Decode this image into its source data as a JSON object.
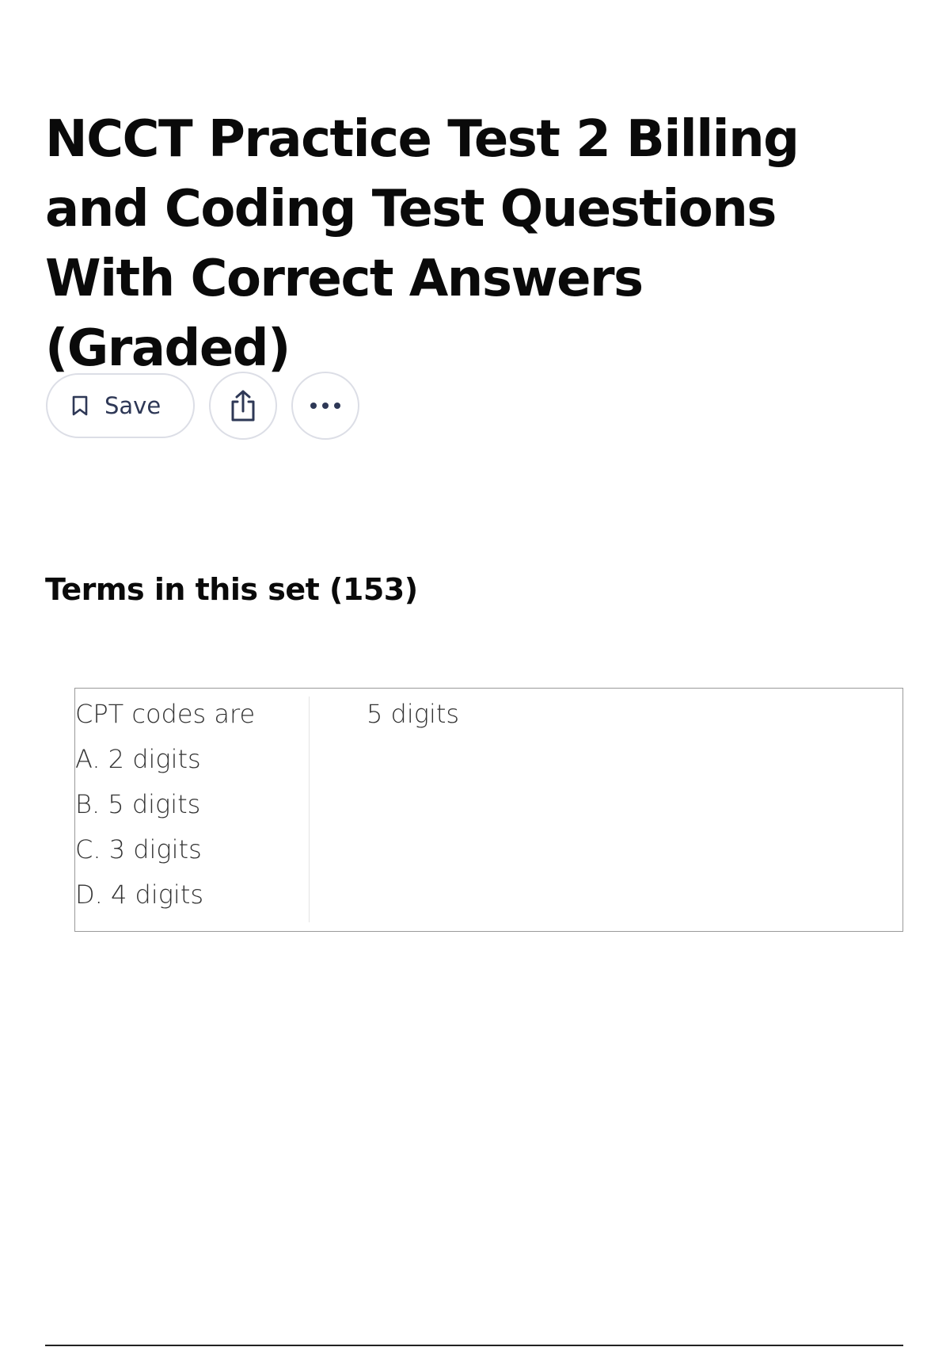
{
  "page": {
    "title": "NCCT Practice Test 2 Billing and Coding Test Questions With Correct Answers (Graded)"
  },
  "actions": {
    "save_label": "Save",
    "save_icon": "bookmark-icon",
    "share_icon": "share-icon",
    "more_icon": "more-options-icon"
  },
  "terms_section": {
    "heading": "Terms in this set (153)"
  },
  "terms": [
    {
      "question_lines": [
        "CPT codes are",
        "A. 2 digits",
        "B. 5 digits",
        "C. 3 digits",
        "D. 4 digits"
      ],
      "answer": "5 digits"
    }
  ],
  "colors": {
    "text_primary": "#0a0a0a",
    "button_border": "#dcdee6",
    "button_text": "#2e3856",
    "card_border": "#9a9a9a"
  }
}
